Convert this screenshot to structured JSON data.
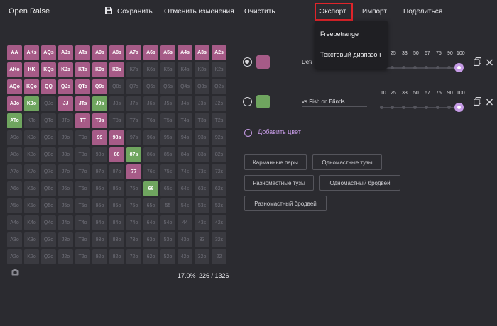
{
  "range": {
    "name": "Open Raise"
  },
  "toolbar": {
    "save": "Сохранить",
    "undo": "Отменить изменения",
    "clear": "Очистить",
    "export": "Экспорт",
    "import": "Импорт",
    "share": "Поделиться"
  },
  "export_menu": {
    "items": [
      "Freebetrange",
      "Текстовый диапазон"
    ]
  },
  "grid": {
    "rows": [
      [
        [
          "AA",
          "p"
        ],
        [
          "AKs",
          "p"
        ],
        [
          "AQs",
          "p"
        ],
        [
          "AJs",
          "p"
        ],
        [
          "ATs",
          "p"
        ],
        [
          "A9s",
          "p"
        ],
        [
          "A8s",
          "p"
        ],
        [
          "A7s",
          "p"
        ],
        [
          "A6s",
          "p"
        ],
        [
          "A5s",
          "p"
        ],
        [
          "A4s",
          "p"
        ],
        [
          "A3s",
          "p"
        ],
        [
          "A2s",
          "p"
        ]
      ],
      [
        [
          "AKo",
          "p"
        ],
        [
          "KK",
          "p"
        ],
        [
          "KQs",
          "p"
        ],
        [
          "KJs",
          "p"
        ],
        [
          "KTs",
          "p"
        ],
        [
          "K9s",
          "p"
        ],
        [
          "K8s",
          "p"
        ],
        [
          "K7s",
          ""
        ],
        [
          "K6s",
          ""
        ],
        [
          "K5s",
          ""
        ],
        [
          "K4s",
          ""
        ],
        [
          "K3s",
          ""
        ],
        [
          "K2s",
          ""
        ]
      ],
      [
        [
          "AQo",
          "p"
        ],
        [
          "KQo",
          "p"
        ],
        [
          "QQ",
          "p"
        ],
        [
          "QJs",
          "p"
        ],
        [
          "QTs",
          "p"
        ],
        [
          "Q9s",
          "p"
        ],
        [
          "Q8s",
          ""
        ],
        [
          "Q7s",
          ""
        ],
        [
          "Q6s",
          ""
        ],
        [
          "Q5s",
          ""
        ],
        [
          "Q4s",
          ""
        ],
        [
          "Q3s",
          ""
        ],
        [
          "Q2s",
          ""
        ]
      ],
      [
        [
          "AJo",
          "p"
        ],
        [
          "KJo",
          "g"
        ],
        [
          "QJo",
          ""
        ],
        [
          "JJ",
          "p"
        ],
        [
          "JTs",
          "p"
        ],
        [
          "J9s",
          "g"
        ],
        [
          "J8s",
          ""
        ],
        [
          "J7s",
          ""
        ],
        [
          "J6s",
          ""
        ],
        [
          "J5s",
          ""
        ],
        [
          "J4s",
          ""
        ],
        [
          "J3s",
          ""
        ],
        [
          "J2s",
          ""
        ]
      ],
      [
        [
          "ATo",
          "g"
        ],
        [
          "KTo",
          ""
        ],
        [
          "QTo",
          ""
        ],
        [
          "JTo",
          ""
        ],
        [
          "TT",
          "p"
        ],
        [
          "T9s",
          "p"
        ],
        [
          "T8s",
          ""
        ],
        [
          "T7s",
          ""
        ],
        [
          "T6s",
          ""
        ],
        [
          "T5s",
          ""
        ],
        [
          "T4s",
          ""
        ],
        [
          "T3s",
          ""
        ],
        [
          "T2s",
          ""
        ]
      ],
      [
        [
          "A9o",
          ""
        ],
        [
          "K9o",
          ""
        ],
        [
          "Q9o",
          ""
        ],
        [
          "J9o",
          ""
        ],
        [
          "T9o",
          ""
        ],
        [
          "99",
          "p"
        ],
        [
          "98s",
          "p"
        ],
        [
          "97s",
          ""
        ],
        [
          "96s",
          ""
        ],
        [
          "95s",
          ""
        ],
        [
          "94s",
          ""
        ],
        [
          "93s",
          ""
        ],
        [
          "92s",
          ""
        ]
      ],
      [
        [
          "A8o",
          ""
        ],
        [
          "K8o",
          ""
        ],
        [
          "Q8o",
          ""
        ],
        [
          "J8o",
          ""
        ],
        [
          "T8o",
          ""
        ],
        [
          "98o",
          ""
        ],
        [
          "88",
          "p"
        ],
        [
          "87s",
          "g"
        ],
        [
          "86s",
          ""
        ],
        [
          "85s",
          ""
        ],
        [
          "84s",
          ""
        ],
        [
          "83s",
          ""
        ],
        [
          "82s",
          ""
        ]
      ],
      [
        [
          "A7o",
          ""
        ],
        [
          "K7o",
          ""
        ],
        [
          "Q7o",
          ""
        ],
        [
          "J7o",
          ""
        ],
        [
          "T7o",
          ""
        ],
        [
          "97o",
          ""
        ],
        [
          "87o",
          ""
        ],
        [
          "77",
          "p"
        ],
        [
          "76s",
          ""
        ],
        [
          "75s",
          ""
        ],
        [
          "74s",
          ""
        ],
        [
          "73s",
          ""
        ],
        [
          "72s",
          ""
        ]
      ],
      [
        [
          "A6o",
          ""
        ],
        [
          "K6o",
          ""
        ],
        [
          "Q6o",
          ""
        ],
        [
          "J6o",
          ""
        ],
        [
          "T6o",
          ""
        ],
        [
          "96o",
          ""
        ],
        [
          "86o",
          ""
        ],
        [
          "76o",
          ""
        ],
        [
          "66",
          "g"
        ],
        [
          "65s",
          ""
        ],
        [
          "64s",
          ""
        ],
        [
          "63s",
          ""
        ],
        [
          "62s",
          ""
        ]
      ],
      [
        [
          "A5o",
          ""
        ],
        [
          "K5o",
          ""
        ],
        [
          "Q5o",
          ""
        ],
        [
          "J5o",
          ""
        ],
        [
          "T5o",
          ""
        ],
        [
          "95o",
          ""
        ],
        [
          "85o",
          ""
        ],
        [
          "75o",
          ""
        ],
        [
          "65o",
          ""
        ],
        [
          "55",
          ""
        ],
        [
          "54s",
          ""
        ],
        [
          "53s",
          ""
        ],
        [
          "52s",
          ""
        ]
      ],
      [
        [
          "A4o",
          ""
        ],
        [
          "K4o",
          ""
        ],
        [
          "Q4o",
          ""
        ],
        [
          "J4o",
          ""
        ],
        [
          "T4o",
          ""
        ],
        [
          "94o",
          ""
        ],
        [
          "84o",
          ""
        ],
        [
          "74o",
          ""
        ],
        [
          "64o",
          ""
        ],
        [
          "54o",
          ""
        ],
        [
          "44",
          ""
        ],
        [
          "43s",
          ""
        ],
        [
          "42s",
          ""
        ]
      ],
      [
        [
          "A3o",
          ""
        ],
        [
          "K3o",
          ""
        ],
        [
          "Q3o",
          ""
        ],
        [
          "J3o",
          ""
        ],
        [
          "T3o",
          ""
        ],
        [
          "93o",
          ""
        ],
        [
          "83o",
          ""
        ],
        [
          "73o",
          ""
        ],
        [
          "63o",
          ""
        ],
        [
          "53o",
          ""
        ],
        [
          "43o",
          ""
        ],
        [
          "33",
          ""
        ],
        [
          "32s",
          ""
        ]
      ],
      [
        [
          "A2o",
          ""
        ],
        [
          "K2o",
          ""
        ],
        [
          "Q2o",
          ""
        ],
        [
          "J2o",
          ""
        ],
        [
          "T2o",
          ""
        ],
        [
          "92o",
          ""
        ],
        [
          "82o",
          ""
        ],
        [
          "72o",
          ""
        ],
        [
          "62o",
          ""
        ],
        [
          "52o",
          ""
        ],
        [
          "42o",
          ""
        ],
        [
          "32o",
          ""
        ],
        [
          "22",
          ""
        ]
      ]
    ]
  },
  "stats": {
    "percent": "17.0%",
    "combos": "226 / 1326"
  },
  "colors": [
    {
      "name": "Defa",
      "hex": "#a65b87",
      "selected": true,
      "slider_value": 100
    },
    {
      "name": "vs Fish on Blinds",
      "hex": "#6fa55f",
      "selected": false,
      "slider_value": 100
    }
  ],
  "slider_ticks": [
    "10",
    "25",
    "33",
    "50",
    "67",
    "75",
    "90",
    "100"
  ],
  "add_color": "Добавить цвет",
  "presets": [
    "Карманные пары",
    "Одномастные тузы",
    "Разномастные тузы",
    "Одномастный бродвей",
    "Разномастный бродвей"
  ],
  "palette": {
    "bg": "#2b2b30",
    "purple": "#a65b87",
    "green": "#6fa55f",
    "accent": "#c69be6",
    "highlight": "#e0242a"
  }
}
